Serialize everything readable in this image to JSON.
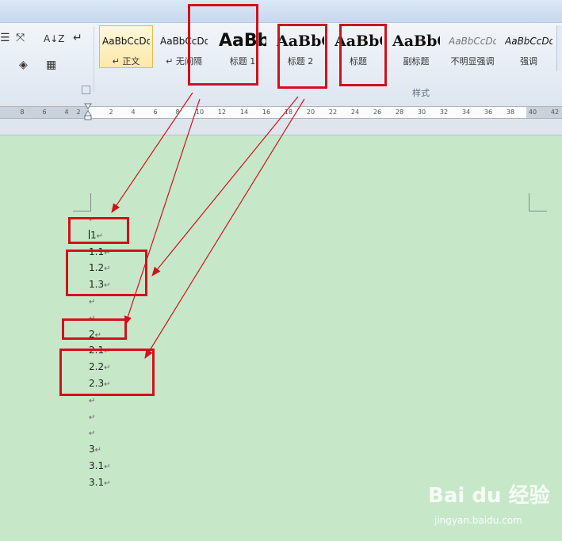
{
  "ribbon": {
    "toolbar_glyphs": {
      "list": "☰",
      "cross": "⤧",
      "sort": "A↓Z",
      "pilcrow": "↵",
      "fill": "◈",
      "border": "▦"
    },
    "styles": [
      {
        "sample": "AaBbCcDd",
        "name": "↵ 正文",
        "selected": true
      },
      {
        "sample": "AaBbCcDd",
        "name": "↵ 无间隔",
        "selected": false
      },
      {
        "sample": "AaBb",
        "name": "标题 1",
        "selected": false
      },
      {
        "sample": "AaBbC",
        "name": "标题 2",
        "selected": false
      },
      {
        "sample": "AaBbC",
        "name": "标题",
        "selected": false
      },
      {
        "sample": "AaBbC",
        "name": "副标题",
        "selected": false
      },
      {
        "sample": "AaBbCcDd",
        "name": "不明显强调",
        "selected": false
      },
      {
        "sample": "AaBbCcDd",
        "name": "强调",
        "selected": false
      }
    ],
    "group_label": "样式"
  },
  "ruler": {
    "ticks": [
      "8",
      "6",
      "4",
      "2",
      "2",
      "4",
      "6",
      "8",
      "10",
      "12",
      "14",
      "16",
      "18",
      "20",
      "22",
      "24",
      "26",
      "28",
      "30",
      "32",
      "34",
      "36",
      "38",
      "40",
      "42"
    ]
  },
  "document": {
    "lines": [
      {
        "text": "",
        "mark": "↵"
      },
      {
        "text": "1",
        "mark": "↵",
        "cursor": true
      },
      {
        "text": "1.1",
        "mark": "↵"
      },
      {
        "text": "1.2",
        "mark": "↵"
      },
      {
        "text": "1.3",
        "mark": "↵"
      },
      {
        "text": "",
        "mark": "↵"
      },
      {
        "text": "",
        "mark": "↵"
      },
      {
        "text": "2",
        "mark": "↵"
      },
      {
        "text": "2.1",
        "mark": "↵"
      },
      {
        "text": "2.2",
        "mark": "↵"
      },
      {
        "text": "2.3",
        "mark": "↵"
      },
      {
        "text": "",
        "mark": "↵"
      },
      {
        "text": "",
        "mark": "↵"
      },
      {
        "text": "",
        "mark": "↵"
      },
      {
        "text": "3",
        "mark": "↵"
      },
      {
        "text": "3.1",
        "mark": "↵"
      },
      {
        "text": "3.1",
        "mark": "↵"
      }
    ]
  },
  "annotation_color": "#d0121b",
  "watermark": {
    "brand": "Bai du 经验",
    "url": "jingyan.baidu.com"
  }
}
